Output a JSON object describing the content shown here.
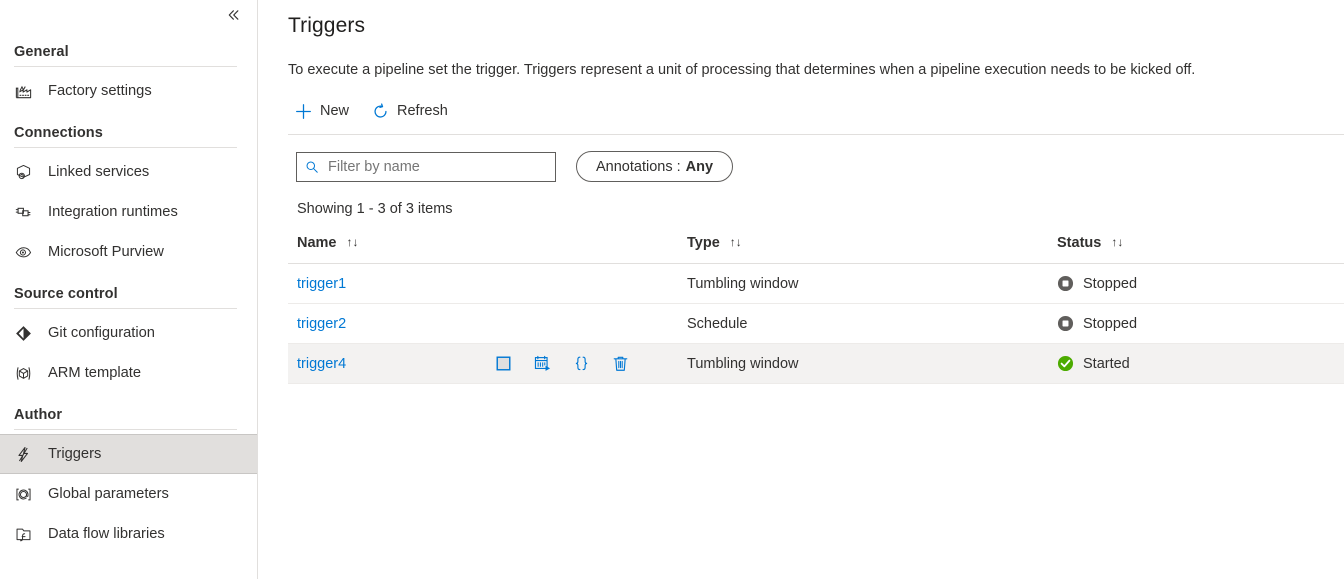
{
  "sidebar": {
    "collapse_label": "«",
    "collapse_name": "collapse-panel-button",
    "sections": [
      {
        "title": "General",
        "items": [
          {
            "label": "Factory settings",
            "icon": "factory-icon",
            "selected": false
          }
        ]
      },
      {
        "title": "Connections",
        "items": [
          {
            "label": "Linked services",
            "icon": "linked-services-icon",
            "selected": false
          },
          {
            "label": "Integration runtimes",
            "icon": "integration-runtimes-icon",
            "selected": false
          },
          {
            "label": "Microsoft Purview",
            "icon": "purview-eye-icon",
            "selected": false
          }
        ]
      },
      {
        "title": "Source control",
        "items": [
          {
            "label": "Git configuration",
            "icon": "git-configuration-icon",
            "selected": false
          },
          {
            "label": "ARM template",
            "icon": "arm-template-icon",
            "selected": false
          }
        ]
      },
      {
        "title": "Author",
        "items": [
          {
            "label": "Triggers",
            "icon": "trigger-bolt-icon",
            "selected": true
          },
          {
            "label": "Global parameters",
            "icon": "global-parameters-icon",
            "selected": false
          },
          {
            "label": "Data flow libraries",
            "icon": "data-flow-libraries-icon",
            "selected": false
          }
        ]
      }
    ]
  },
  "main": {
    "title": "Triggers",
    "description": "To execute a pipeline set the trigger. Triggers represent a unit of processing that determines when a pipeline execution needs to be kicked off.",
    "toolbar": {
      "new_label": "New",
      "refresh_label": "Refresh"
    },
    "filter": {
      "placeholder": "Filter by name",
      "value": "",
      "annotations_prefix": "Annotations : ",
      "annotations_value": "Any"
    },
    "showing": "Showing 1 - 3 of 3 items",
    "table": {
      "columns": [
        {
          "label": "Name",
          "sort": "↑↓"
        },
        {
          "label": "Type",
          "sort": "↑↓"
        },
        {
          "label": "Status",
          "sort": "↑↓"
        }
      ],
      "row_actions": [
        {
          "name": "stop-trigger-action",
          "label": "Stop"
        },
        {
          "name": "rerun-trigger-action",
          "label": "Rerun"
        },
        {
          "name": "code-json-action",
          "label": "Code"
        },
        {
          "name": "delete-trigger-action",
          "label": "Delete"
        }
      ],
      "rows": [
        {
          "name": "trigger1",
          "type": "Tumbling window",
          "status": "Stopped",
          "status_icon": "stopped-icon",
          "hovered": false
        },
        {
          "name": "trigger2",
          "type": "Schedule",
          "status": "Stopped",
          "status_icon": "stopped-icon",
          "hovered": false
        },
        {
          "name": "trigger4",
          "type": "Tumbling window",
          "status": "Started",
          "status_icon": "started-icon",
          "hovered": true
        }
      ]
    }
  },
  "colors": {
    "accent": "#0078d4",
    "link": "#0078d4",
    "started": "#498205",
    "stopped": "#605e5c",
    "selected_nav_bg": "#e1dfdd",
    "hover_row": "#f3f2f1"
  }
}
